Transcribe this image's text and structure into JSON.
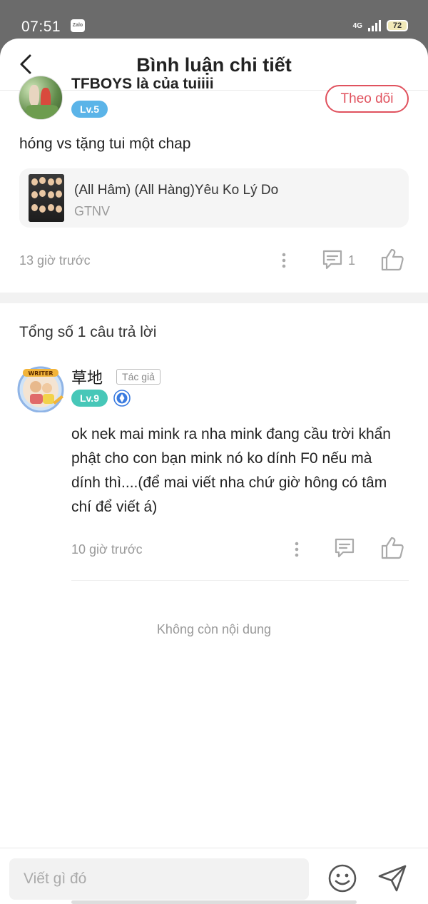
{
  "status_bar": {
    "time": "07:51",
    "app_badge": "Zalo",
    "network": "4G",
    "battery": "72"
  },
  "header": {
    "title": "Bình luận chi tiết",
    "back_icon": "chevron-left-icon"
  },
  "main_comment": {
    "username": "TFBOYS là của tuiiii",
    "level": "Lv.5",
    "follow_label": "Theo dõi",
    "text": "hóng vs tặng tui một chap",
    "book": {
      "title": "(All Hâm) (All Hàng)Yêu Ko Lý Do",
      "author": "GTNV"
    },
    "time": "13 giờ trước",
    "reply_count": "1"
  },
  "replies_section": {
    "total_label": "Tổng số 1 câu trả lời",
    "replies": [
      {
        "username": "草地",
        "tag": "Tác giả",
        "level": "Lv.9",
        "text": "ok nek mai mink ra nha mink đang cầu trời khẩn phật cho con bạn mink nó ko dính F0 nếu mà dính thì....(để mai viết nha chứ giờ hông có tâm chí để viết á)",
        "time": "10 giờ trước"
      }
    ],
    "no_more": "Không còn nội dung"
  },
  "composer": {
    "placeholder": "Viết gì đó",
    "emoji_icon": "emoji-icon",
    "send_icon": "send-icon"
  },
  "colors": {
    "accent_red": "#e0525e",
    "lv5_blue": "#5bb4e8",
    "lv9_teal": "#47c7b8"
  }
}
